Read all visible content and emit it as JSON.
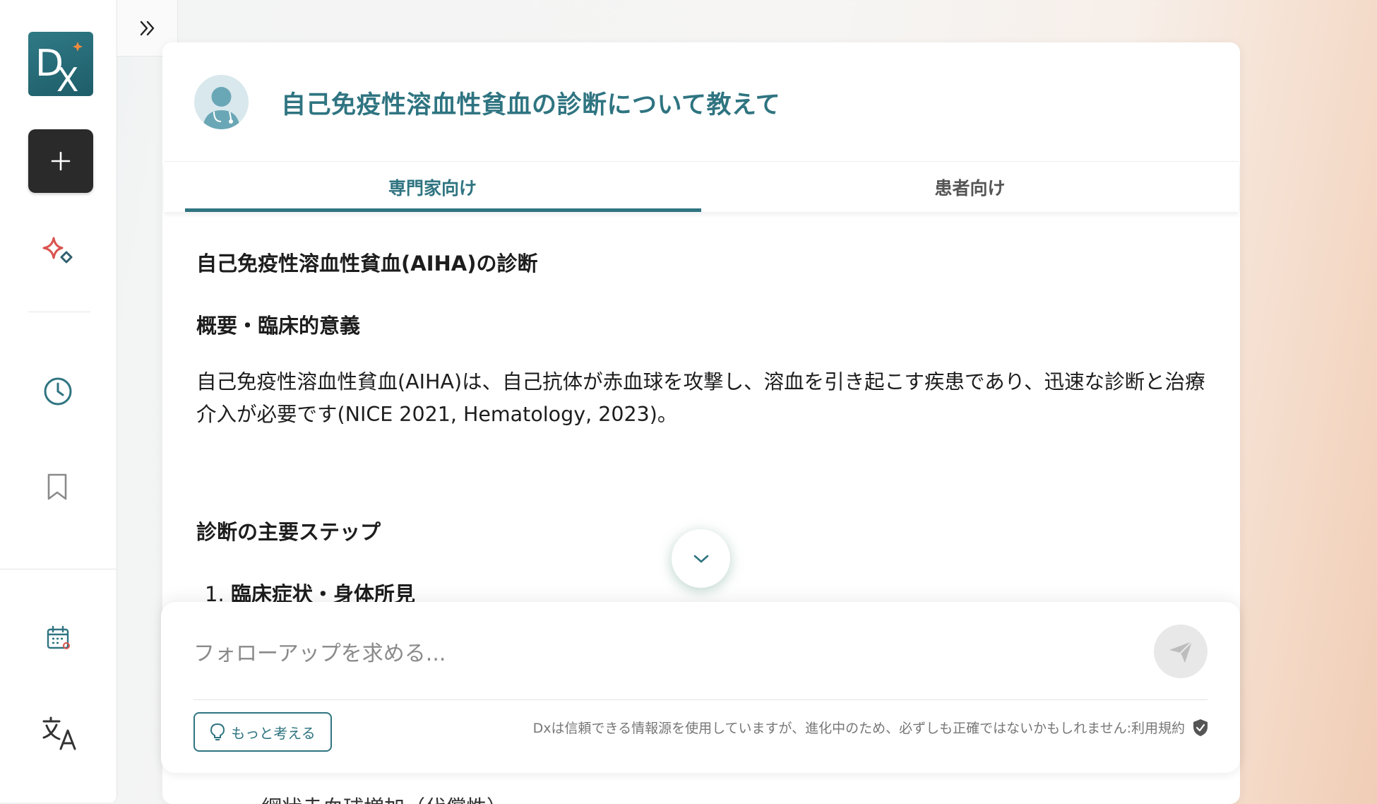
{
  "sidebar": {
    "logo_text": "Dx",
    "icons": [
      "new-chat-icon",
      "sparkle-icon",
      "history-icon",
      "bookmark-icon",
      "calendar-icon",
      "translate-icon"
    ]
  },
  "conversation": {
    "question": "自己免疫性溶血性貧血の診断について教えて",
    "tabs": [
      {
        "label": "専門家向け",
        "active": true
      },
      {
        "label": "患者向け",
        "active": false
      }
    ]
  },
  "answer": {
    "title": "自己免疫性溶血性貧血(AIHA)の診断",
    "section1_heading": "概要・臨床的意義",
    "section1_body": "自己免疫性溶血性貧血(AIHA)は、自己抗体が赤血球を攻撃し、溶血を引き起こす疾患であり、迅速な診断と治療介入が必要です(NICE 2021, Hematology, 2023)。",
    "section2_heading": "診断の主要ステップ",
    "step1_number": "1.",
    "step1_label": "臨床症状・身体所見",
    "peek_text": "網状赤血球増加（代償性）"
  },
  "composer": {
    "placeholder": "フォローアップを求める...",
    "think_label": "もっと考える",
    "disclaimer": "Dxは信頼できる情報源を使用していますが、進化中のため、必ずしも正確ではないかもしれません:利用規約"
  },
  "colors": {
    "accent": "#2f7481",
    "logo_bg": "#276c78",
    "logo_star": "#f08a3c",
    "sparkle_red": "#d9534f"
  }
}
